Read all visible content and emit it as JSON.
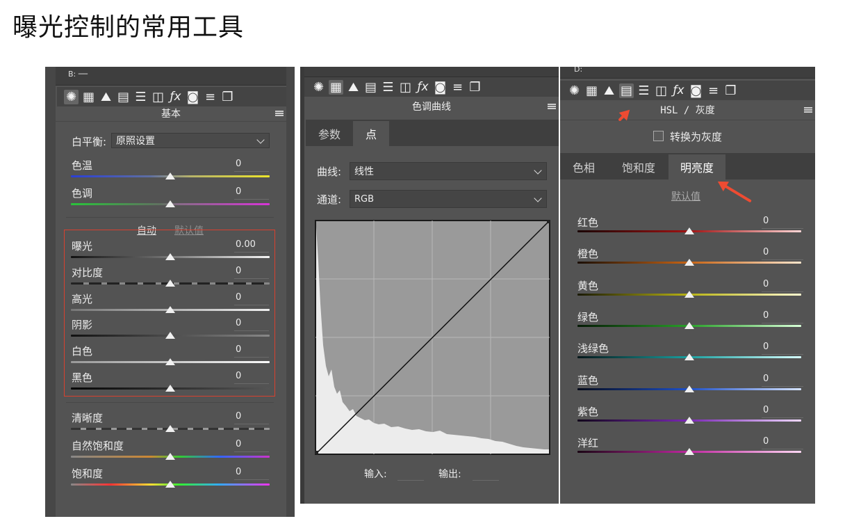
{
  "doc_title": "曝光控制的常用工具",
  "colors": {
    "panel_bg": "#535353",
    "toolbar_bg": "#444444",
    "highlight_box": "#d9412f",
    "arrow": "#ee4b32"
  },
  "toolbar_icons": [
    "aperture-icon",
    "grid-icon",
    "mountain-icon",
    "hsl-icon",
    "split-toning-icon",
    "lens-icon",
    "fx-icon",
    "camera-icon",
    "sliders-icon",
    "presets-icon"
  ],
  "basic": {
    "strip_text": "B: ──",
    "header": "基本",
    "white_balance": {
      "label": "白平衡:",
      "value": "原照设置"
    },
    "temp": {
      "label": "色温",
      "value": "0",
      "position": 0.5
    },
    "tint": {
      "label": "色调",
      "value": "0",
      "position": 0.5
    },
    "auto_label": "自动",
    "default_label": "默认值",
    "tone_sliders": [
      {
        "label": "曝光",
        "value": "0.00",
        "position": 0.5
      },
      {
        "label": "对比度",
        "value": "0",
        "position": 0.5
      },
      {
        "label": "高光",
        "value": "0",
        "position": 0.5
      },
      {
        "label": "阴影",
        "value": "0",
        "position": 0.5
      },
      {
        "label": "白色",
        "value": "0",
        "position": 0.5
      },
      {
        "label": "黑色",
        "value": "0",
        "position": 0.5
      }
    ],
    "presence_sliders": [
      {
        "label": "清晰度",
        "value": "0",
        "position": 0.5
      },
      {
        "label": "自然饱和度",
        "value": "0",
        "position": 0.5
      },
      {
        "label": "饱和度",
        "value": "0",
        "position": 0.5
      }
    ]
  },
  "curve": {
    "header": "色调曲线",
    "tabs": [
      "参数",
      "点"
    ],
    "active_tab": 1,
    "curve_label": "曲线:",
    "curve_value": "线性",
    "channel_label": "通道:",
    "channel_value": "RGB",
    "input_label": "输入:",
    "output_label": "输出:"
  },
  "hsl": {
    "strip_text": "D:",
    "header": "HSL / 灰度",
    "convert_label": "转换为灰度",
    "convert_checked": false,
    "tabs": [
      "色相",
      "饱和度",
      "明亮度"
    ],
    "active_tab": 2,
    "default_label": "默认值",
    "sliders": [
      {
        "label": "红色",
        "value": "0",
        "position": 0.5
      },
      {
        "label": "橙色",
        "value": "0",
        "position": 0.5
      },
      {
        "label": "黄色",
        "value": "0",
        "position": 0.5
      },
      {
        "label": "绿色",
        "value": "0",
        "position": 0.5
      },
      {
        "label": "浅绿色",
        "value": "0",
        "position": 0.5
      },
      {
        "label": "蓝色",
        "value": "0",
        "position": 0.5
      },
      {
        "label": "紫色",
        "value": "0",
        "position": 0.5
      },
      {
        "label": "洋红",
        "value": "0",
        "position": 0.5
      }
    ]
  }
}
